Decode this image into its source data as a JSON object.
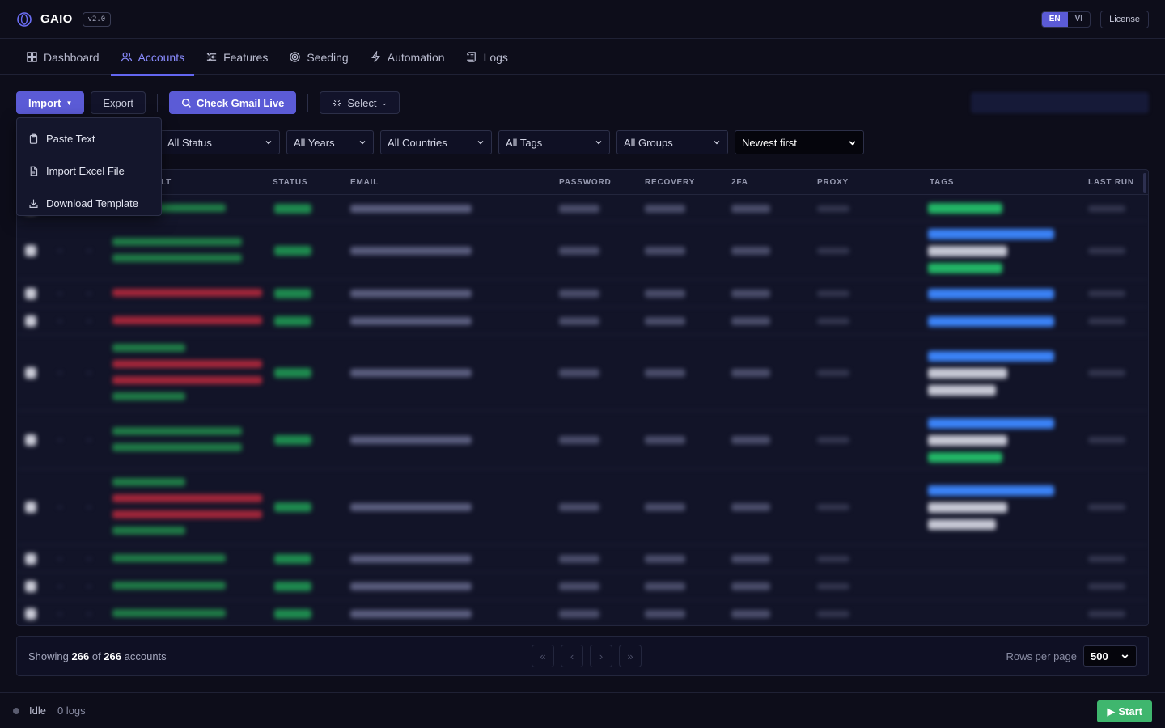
{
  "app": {
    "name": "GAIO",
    "version": "v2.0"
  },
  "lang": {
    "en": "EN",
    "vi": "VI",
    "license": "License"
  },
  "nav": [
    {
      "label": "Dashboard",
      "icon": "grid-icon"
    },
    {
      "label": "Accounts",
      "icon": "users-icon"
    },
    {
      "label": "Features",
      "icon": "sliders-icon"
    },
    {
      "label": "Seeding",
      "icon": "target-icon"
    },
    {
      "label": "Automation",
      "icon": "bolt-icon"
    },
    {
      "label": "Logs",
      "icon": "scroll-icon"
    }
  ],
  "toolbar": {
    "import": "Import",
    "export": "Export",
    "check_gmail": "Check Gmail Live",
    "select": "Select"
  },
  "import_menu": [
    {
      "label": "Paste Text",
      "icon": "clipboard-icon"
    },
    {
      "label": "Import Excel File",
      "icon": "file-icon"
    },
    {
      "label": "Download Template",
      "icon": "download-icon"
    }
  ],
  "filters": {
    "status": "All Status",
    "years": "All Years",
    "countries": "All Countries",
    "tags": "All Tags",
    "groups": "All Groups",
    "sort": "Newest first"
  },
  "table": {
    "columns": {
      "result_partial": "LT",
      "status": "STATUS",
      "email": "EMAIL",
      "password": "PASSWORD",
      "recovery": "RECOVERY",
      "twofa": "2FA",
      "proxy": "PROXY",
      "tags": "TAGS",
      "last_run": "LAST RUN"
    }
  },
  "pagination": {
    "showing_prefix": "Showing",
    "shown": "266",
    "of": "of",
    "total": "266",
    "suffix": "accounts",
    "first": "«",
    "prev": "‹",
    "next": "›",
    "last": "»",
    "rows_label": "Rows per page",
    "rows_value": "500"
  },
  "status": {
    "state": "Idle",
    "logs": "0 logs",
    "start": "Start",
    "start_icon": "▶"
  }
}
